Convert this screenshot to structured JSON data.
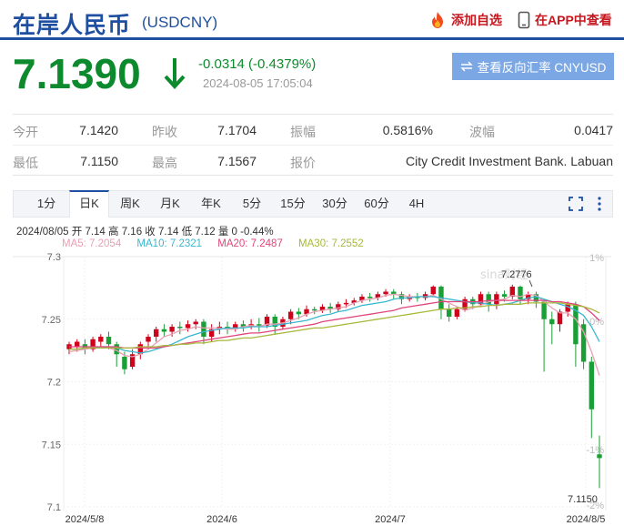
{
  "header": {
    "title": "在岸人民币",
    "code": "(USDCNY)",
    "add_fav_label": "添加自选",
    "app_label": "在APP中查看"
  },
  "quote": {
    "price": "7.1390",
    "change": "-0.0314 (-0.4379%)",
    "time": "2024-08-05 17:05:04",
    "reverse_label": "查看反向汇率 CNYUSD"
  },
  "stats": {
    "rows": [
      [
        {
          "label": "今开",
          "value": "7.1420"
        },
        {
          "label": "昨收",
          "value": "7.1704"
        },
        {
          "label": "振幅",
          "value": "0.5816%"
        },
        {
          "label": "波幅",
          "value": "0.0417"
        }
      ],
      [
        {
          "label": "最低",
          "value": "7.1150"
        },
        {
          "label": "最高",
          "value": "7.1567"
        },
        {
          "label": "报价",
          "value": "City Credit Investment Bank. Labuan"
        }
      ]
    ]
  },
  "tabs": [
    "1分",
    "日K",
    "周K",
    "月K",
    "年K",
    "5分",
    "15分",
    "30分",
    "60分",
    "4H"
  ],
  "active_tab": "日K",
  "legend": {
    "ohlc": "2024/08/05 开 7.14 高 7.16 收 7.14 低 7.12 量 0 -0.44%",
    "ma5": "MA5: 7.2054",
    "ma10": "MA10: 7.2321",
    "ma20": "MA20: 7.2487",
    "ma30": "MA30: 7.2552"
  },
  "colors": {
    "up": "#d0021b",
    "down": "#1a9e36",
    "ma5": "#e8a0b4",
    "ma10": "#3ab7d0",
    "ma20": "#e0457b",
    "ma30": "#a7b83b",
    "brand": "#1e4fa1"
  },
  "chart_data": {
    "type": "candlestick",
    "y_ticks": [
      "7.3",
      "7.25",
      "7.2",
      "7.15",
      "7.1"
    ],
    "y_right_ticks": [
      "1%",
      "0%",
      "-1%",
      "-2%"
    ],
    "x_ticks": [
      "2024/5/8",
      "2024/6",
      "2024/7",
      "2024/8/5"
    ],
    "ylim": [
      7.1,
      7.3
    ],
    "annotations": {
      "high": "7.2776",
      "low": "7.1150"
    },
    "watermark": "sina财经",
    "candles": [
      [
        7.226,
        7.23,
        7.222,
        7.232
      ],
      [
        7.228,
        7.232,
        7.224,
        7.234
      ],
      [
        7.23,
        7.226,
        7.222,
        7.234
      ],
      [
        7.226,
        7.234,
        7.224,
        7.236
      ],
      [
        7.232,
        7.236,
        7.228,
        7.238
      ],
      [
        7.236,
        7.23,
        7.226,
        7.24
      ],
      [
        7.23,
        7.222,
        7.212,
        7.232
      ],
      [
        7.22,
        7.21,
        7.206,
        7.224
      ],
      [
        7.212,
        7.222,
        7.21,
        7.226
      ],
      [
        7.222,
        7.23,
        7.218,
        7.232
      ],
      [
        7.232,
        7.236,
        7.228,
        7.238
      ],
      [
        7.236,
        7.242,
        7.232,
        7.244
      ],
      [
        7.242,
        7.24,
        7.236,
        7.246
      ],
      [
        7.24,
        7.244,
        7.236,
        7.246
      ],
      [
        7.244,
        7.243,
        7.238,
        7.248
      ],
      [
        7.243,
        7.246,
        7.24,
        7.249
      ],
      [
        7.246,
        7.248,
        7.242,
        7.25
      ],
      [
        7.248,
        7.236,
        7.23,
        7.25
      ],
      [
        7.236,
        7.242,
        7.232,
        7.246
      ],
      [
        7.242,
        7.244,
        7.238,
        7.248
      ],
      [
        7.244,
        7.242,
        7.238,
        7.248
      ],
      [
        7.242,
        7.246,
        7.24,
        7.248
      ],
      [
        7.246,
        7.244,
        7.24,
        7.249
      ],
      [
        7.244,
        7.246,
        7.242,
        7.25
      ],
      [
        7.246,
        7.245,
        7.24,
        7.251
      ],
      [
        7.245,
        7.252,
        7.243,
        7.254
      ],
      [
        7.252,
        7.244,
        7.238,
        7.254
      ],
      [
        7.244,
        7.25,
        7.242,
        7.252
      ],
      [
        7.25,
        7.256,
        7.246,
        7.258
      ],
      [
        7.256,
        7.254,
        7.25,
        7.259
      ],
      [
        7.254,
        7.258,
        7.252,
        7.261
      ],
      [
        7.258,
        7.257,
        7.254,
        7.26
      ],
      [
        7.257,
        7.26,
        7.255,
        7.262
      ],
      [
        7.26,
        7.258,
        7.255,
        7.263
      ],
      [
        7.258,
        7.262,
        7.256,
        7.264
      ],
      [
        7.262,
        7.263,
        7.259,
        7.266
      ],
      [
        7.263,
        7.265,
        7.261,
        7.267
      ],
      [
        7.265,
        7.268,
        7.263,
        7.27
      ],
      [
        7.268,
        7.267,
        7.264,
        7.271
      ],
      [
        7.267,
        7.27,
        7.265,
        7.272
      ],
      [
        7.27,
        7.272,
        7.268,
        7.274
      ],
      [
        7.272,
        7.27,
        7.266,
        7.274
      ],
      [
        7.27,
        7.266,
        7.262,
        7.272
      ],
      [
        7.266,
        7.268,
        7.264,
        7.27
      ],
      [
        7.268,
        7.267,
        7.264,
        7.271
      ],
      [
        7.267,
        7.27,
        7.265,
        7.272
      ],
      [
        7.27,
        7.276,
        7.268,
        7.277
      ],
      [
        7.276,
        7.258,
        7.25,
        7.277
      ],
      [
        7.258,
        7.252,
        7.248,
        7.262
      ],
      [
        7.252,
        7.258,
        7.25,
        7.26
      ],
      [
        7.258,
        7.266,
        7.256,
        7.268
      ],
      [
        7.266,
        7.262,
        7.258,
        7.268
      ],
      [
        7.262,
        7.27,
        7.26,
        7.272
      ],
      [
        7.27,
        7.262,
        7.256,
        7.272
      ],
      [
        7.262,
        7.27,
        7.258,
        7.272
      ],
      [
        7.27,
        7.268,
        7.264,
        7.273
      ],
      [
        7.268,
        7.276,
        7.266,
        7.2776
      ],
      [
        7.276,
        7.266,
        7.262,
        7.277
      ],
      [
        7.266,
        7.27,
        7.262,
        7.272
      ],
      [
        7.27,
        7.264,
        7.259,
        7.272
      ],
      [
        7.264,
        7.25,
        7.208,
        7.266
      ],
      [
        7.25,
        7.246,
        7.23,
        7.256
      ],
      [
        7.246,
        7.256,
        7.24,
        7.258
      ],
      [
        7.256,
        7.262,
        7.252,
        7.264
      ],
      [
        7.262,
        7.23,
        7.212,
        7.264
      ],
      [
        7.246,
        7.216,
        7.21,
        7.25
      ],
      [
        7.216,
        7.178,
        7.155,
        7.22
      ],
      [
        7.142,
        7.139,
        7.115,
        7.157
      ]
    ],
    "ma5": [
      7.224,
      7.225,
      7.226,
      7.227,
      7.228,
      7.227,
      7.225,
      7.221,
      7.22,
      7.222,
      7.226,
      7.231,
      7.236,
      7.238,
      7.241,
      7.242,
      7.244,
      7.243,
      7.243,
      7.243,
      7.242,
      7.242,
      7.244,
      7.245,
      7.244,
      7.246,
      7.246,
      7.247,
      7.249,
      7.251,
      7.254,
      7.256,
      7.257,
      7.258,
      7.259,
      7.26,
      7.263,
      7.265,
      7.266,
      7.267,
      7.269,
      7.27,
      7.269,
      7.268,
      7.268,
      7.268,
      7.269,
      7.266,
      7.263,
      7.26,
      7.257,
      7.259,
      7.261,
      7.264,
      7.265,
      7.266,
      7.269,
      7.268,
      7.27,
      7.269,
      7.264,
      7.259,
      7.255,
      7.255,
      7.25,
      7.24,
      7.224,
      7.205
    ],
    "ma10": [
      7.226,
      7.226,
      7.227,
      7.227,
      7.228,
      7.228,
      7.227,
      7.225,
      7.224,
      7.223,
      7.224,
      7.226,
      7.228,
      7.23,
      7.233,
      7.236,
      7.238,
      7.24,
      7.241,
      7.242,
      7.243,
      7.243,
      7.243,
      7.244,
      7.244,
      7.244,
      7.245,
      7.246,
      7.247,
      7.248,
      7.249,
      7.251,
      7.253,
      7.254,
      7.256,
      7.257,
      7.259,
      7.261,
      7.262,
      7.263,
      7.264,
      7.266,
      7.267,
      7.267,
      7.268,
      7.268,
      7.268,
      7.267,
      7.266,
      7.265,
      7.264,
      7.263,
      7.263,
      7.262,
      7.261,
      7.262,
      7.263,
      7.265,
      7.267,
      7.268,
      7.266,
      7.264,
      7.262,
      7.26,
      7.257,
      7.253,
      7.244,
      7.232
    ],
    "ma20": [
      7.228,
      7.228,
      7.228,
      7.228,
      7.228,
      7.228,
      7.228,
      7.227,
      7.227,
      7.227,
      7.227,
      7.227,
      7.228,
      7.229,
      7.23,
      7.231,
      7.232,
      7.233,
      7.234,
      7.235,
      7.236,
      7.237,
      7.238,
      7.239,
      7.239,
      7.24,
      7.241,
      7.242,
      7.243,
      7.244,
      7.245,
      7.246,
      7.248,
      7.249,
      7.25,
      7.251,
      7.252,
      7.253,
      7.254,
      7.255,
      7.256,
      7.257,
      7.259,
      7.26,
      7.261,
      7.262,
      7.263,
      7.264,
      7.264,
      7.264,
      7.264,
      7.264,
      7.264,
      7.265,
      7.265,
      7.265,
      7.265,
      7.265,
      7.265,
      7.265,
      7.265,
      7.264,
      7.264,
      7.263,
      7.262,
      7.26,
      7.255,
      7.249
    ],
    "ma30": [
      7.226,
      7.226,
      7.227,
      7.227,
      7.227,
      7.227,
      7.227,
      7.227,
      7.227,
      7.228,
      7.228,
      7.228,
      7.229,
      7.229,
      7.23,
      7.23,
      7.231,
      7.231,
      7.232,
      7.233,
      7.233,
      7.234,
      7.235,
      7.235,
      7.236,
      7.237,
      7.238,
      7.239,
      7.24,
      7.241,
      7.242,
      7.243,
      7.243,
      7.244,
      7.245,
      7.246,
      7.247,
      7.248,
      7.249,
      7.25,
      7.251,
      7.252,
      7.253,
      7.254,
      7.255,
      7.256,
      7.257,
      7.258,
      7.258,
      7.259,
      7.259,
      7.26,
      7.26,
      7.261,
      7.261,
      7.262,
      7.262,
      7.262,
      7.263,
      7.263,
      7.263,
      7.263,
      7.263,
      7.262,
      7.261,
      7.26,
      7.258,
      7.255
    ]
  }
}
